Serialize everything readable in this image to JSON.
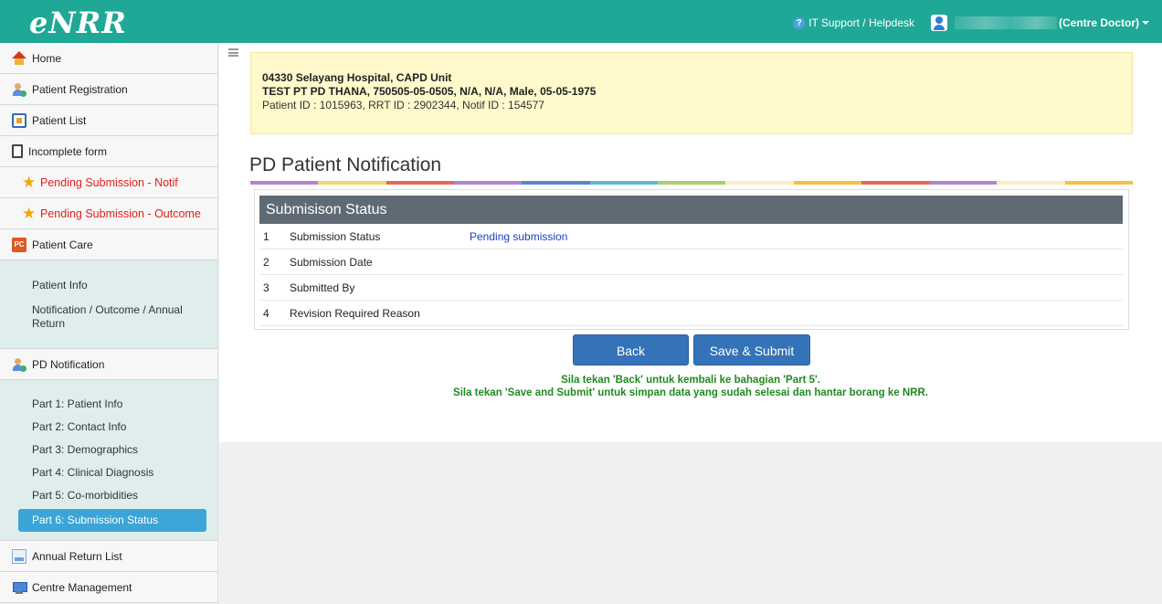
{
  "app": {
    "logo": "eNRR",
    "helpdesk": "IT Support / Helpdesk",
    "user_role": "(Centre Doctor)"
  },
  "sidebar": {
    "items": [
      {
        "label": "Home",
        "icon": "home-icon"
      },
      {
        "label": "Patient Registration",
        "icon": "user-add-icon"
      },
      {
        "label": "Patient List",
        "icon": "list-icon"
      },
      {
        "label": "Incomplete form",
        "icon": "clipboard-icon"
      },
      {
        "label": "Pending Submission - Notif",
        "icon": "star-icon"
      },
      {
        "label": "Pending Submission - Outcome",
        "icon": "star-icon"
      },
      {
        "label": "Patient Care",
        "icon": "pc-icon"
      }
    ],
    "patient_care_sub": [
      "Patient Info",
      "Notification / Outcome / Annual Return"
    ],
    "pd_notification": {
      "label": "PD Notification",
      "icon": "user-add-icon"
    },
    "pd_sub": [
      "Part 1: Patient Info",
      "Part 2: Contact Info",
      "Part 3: Demographics",
      "Part 4: Clinical Diagnosis",
      "Part 5: Co-morbidities",
      "Part 6: Submission Status"
    ],
    "bottom_items": [
      {
        "label": "Annual Return List",
        "icon": "document-icon"
      },
      {
        "label": "Centre Management",
        "icon": "monitor-icon"
      }
    ]
  },
  "patient": {
    "centre": "04330 Selayang Hospital, CAPD Unit",
    "details": "TEST PT PD THANA, 750505-05-0505, N/A, N/A, Male, 05-05-1975",
    "ids": "Patient ID : 1015963, RRT ID : 2902344, Notif ID : 154577"
  },
  "page": {
    "title": "PD Patient Notification"
  },
  "colors": {
    "rainbow": [
      "#b084cc",
      "#f5d56c",
      "#e56a5a",
      "#b084cc",
      "#5a86c8",
      "#5ab8d8",
      "#a8d070",
      "#f5f0c0",
      "#f5c046",
      "#e56a5a",
      "#b084cc",
      "#f5f0c0",
      "#f5c046"
    ]
  },
  "status": {
    "heading": "Submisison Status",
    "rows": [
      {
        "num": "1",
        "label": "Submission Status",
        "value": "Pending submission"
      },
      {
        "num": "2",
        "label": "Submission Date",
        "value": ""
      },
      {
        "num": "3",
        "label": "Submitted By",
        "value": ""
      },
      {
        "num": "4",
        "label": "Revision Required Reason",
        "value": ""
      }
    ]
  },
  "actions": {
    "back": "Back",
    "save": "Save & Submit",
    "hint1": "Sila tekan 'Back' untuk kembali ke bahagian 'Part 5'.",
    "hint2": "Sila tekan 'Save and Submit' untuk simpan data yang sudah selesai dan hantar borang ke NRR."
  }
}
